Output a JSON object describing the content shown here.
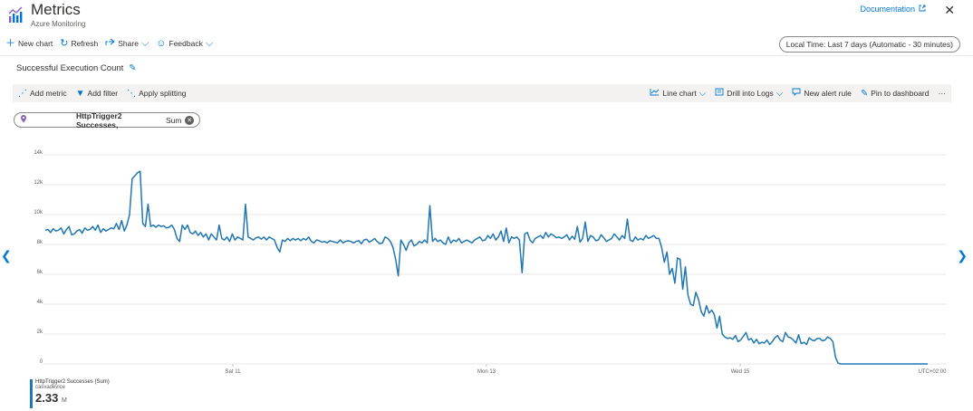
{
  "header": {
    "title": "Metrics",
    "subtitle": "Azure Monitoring",
    "doc_link": "Documentation",
    "close_glyph": "✕"
  },
  "toolbar": {
    "new_chart": "New chart",
    "refresh": "Refresh",
    "share": "Share",
    "feedback": "Feedback"
  },
  "time_range": "Local Time: Last 7 days (Automatic - 30 minutes)",
  "chart_header": {
    "title": "Successful Execution Count"
  },
  "command_bar": {
    "add_metric": "Add metric",
    "add_filter": "Add filter",
    "apply_splitting": "Apply splitting",
    "line_chart": "Line chart",
    "drill_logs": "Drill into Logs",
    "new_alert": "New alert rule",
    "pin_dashboard": "Pin to dashboard",
    "more": "···"
  },
  "metric_pill": {
    "name": "HttpTrigger2 Successes,",
    "agg": "Sum"
  },
  "legend": {
    "name": "HttpTrigger2 Successes (Sum)",
    "resource": "casvadevice",
    "value": "2.33",
    "unit": "M"
  },
  "colors": {
    "accent": "#0078d4",
    "series": "#1f77b4",
    "gridline": "#e1dfdd"
  },
  "chart_data": {
    "type": "line",
    "title": "",
    "y_ticks": [
      "0",
      "2k",
      "4k",
      "6k",
      "8k",
      "10k",
      "12k",
      "14k"
    ],
    "ylim": [
      0,
      14000
    ],
    "x_ticks": [
      "Sat 11",
      "Mon 13",
      "Wed 15",
      "UTC+02:00"
    ],
    "series": [
      {
        "name": "HttpTrigger2 Successes (Sum)",
        "values": [
          8950,
          9000,
          8800,
          9050,
          8900,
          8950,
          9100,
          8700,
          9000,
          9200,
          8650,
          8700,
          8900,
          9000,
          8750,
          9100,
          8950,
          9000,
          9200,
          8950,
          9300,
          8800,
          9050,
          8900,
          9000,
          9100,
          9050,
          9400,
          9000,
          9600,
          8900,
          9300,
          10000,
          12400,
          12600,
          12800,
          12900,
          9400,
          9200,
          10700,
          9200,
          9300,
          9150,
          9300,
          9200,
          9250,
          9100,
          9150,
          9300,
          9000,
          8400,
          8200,
          9300,
          9000,
          9300,
          8800,
          8700,
          8900,
          8600,
          8800,
          8500,
          8700,
          8300,
          8700,
          8500,
          8300,
          9300,
          8400,
          8300,
          8500,
          8200,
          8700,
          8300,
          8500,
          8400,
          8300,
          10700,
          8500,
          8400,
          8300,
          8450,
          8500,
          8350,
          8500,
          8300,
          8500,
          8400,
          8300,
          7800,
          7500,
          8300,
          8200,
          8400,
          8250,
          8400,
          8300,
          8400,
          8250,
          8400,
          8300,
          8500,
          8200,
          8100,
          8300,
          8250,
          8150,
          8200,
          8100,
          8250,
          8200,
          8150,
          8100,
          8300,
          8100,
          8200,
          8250,
          8200,
          8100,
          8200,
          8250,
          8050,
          8300,
          8350,
          8150,
          8250,
          8400,
          8200,
          8050,
          8100,
          8500,
          8400,
          8200,
          7800,
          7000,
          5900,
          8300,
          8000,
          7600,
          8100,
          8300,
          7900,
          8000,
          8200,
          8100,
          8300,
          8100,
          10600,
          8200,
          8400,
          8200,
          8300,
          8100,
          8000,
          8500,
          8100,
          8300,
          8200,
          8400,
          8100,
          8200,
          8300,
          8200,
          8100,
          8300,
          8400,
          8500,
          8250,
          8300,
          8600,
          8400,
          8700,
          8300,
          8500,
          8900,
          8200,
          9100,
          8100,
          8500,
          8400,
          8500,
          8300,
          6100,
          8700,
          8800,
          8300,
          8100,
          8400,
          8500,
          8600,
          8400,
          8800,
          8500,
          8700,
          8600,
          8450,
          8500,
          8400,
          8500,
          8650,
          8300,
          8550,
          8350,
          9200,
          8150,
          8400,
          9500,
          8200,
          8600,
          8500,
          8250,
          8300,
          8650,
          8450,
          8200,
          8300,
          8400,
          8700,
          8500,
          8300,
          8600,
          8400,
          9700,
          8300,
          8200,
          8500,
          8300,
          8400,
          8300,
          8600,
          8400,
          8500,
          8600,
          8400,
          8400,
          7800,
          6800,
          7500,
          6000,
          6400,
          5400,
          7100,
          7000,
          5000,
          6500,
          4600,
          4000,
          3900,
          4800,
          4300,
          3500,
          3200,
          3900,
          3400,
          3600,
          3300,
          2400,
          3200,
          2000,
          1800,
          1700,
          1750,
          1650,
          1900,
          1500,
          1600,
          1850,
          2100,
          1600,
          1700,
          1400,
          1650,
          1350,
          1450,
          1400,
          1600,
          1300,
          1500,
          1750,
          1900,
          1600,
          1500,
          2100,
          1800,
          1750,
          1600,
          1400,
          1950,
          1350,
          1450,
          1300,
          1750,
          1600,
          1550,
          1700,
          1700,
          1550,
          1600,
          1800,
          1700,
          1500,
          450,
          50,
          0,
          0,
          0,
          0,
          0,
          0,
          0,
          0,
          0,
          0,
          0,
          0,
          0,
          0,
          0,
          0,
          0,
          0,
          0,
          0,
          0,
          0,
          0,
          0,
          0,
          0,
          0,
          0,
          0,
          0,
          0,
          0,
          0,
          0
        ]
      }
    ]
  }
}
